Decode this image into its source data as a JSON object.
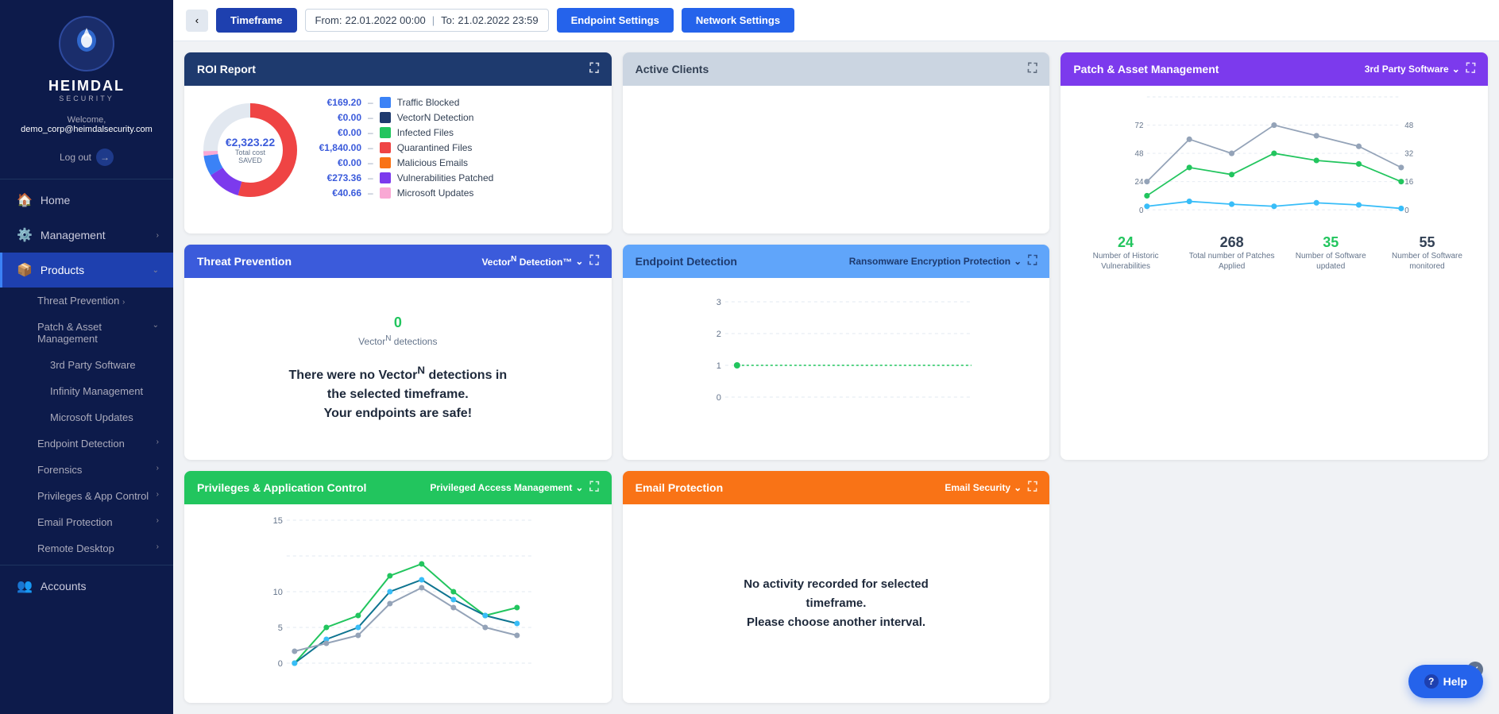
{
  "sidebar": {
    "logo_text": "HEIMDAL",
    "logo_sub": "SECURITY",
    "welcome": "Welcome,",
    "email": "demo_corp@heimdalsecurity.com",
    "logout": "Log out",
    "nav_items": [
      {
        "id": "home",
        "label": "Home",
        "icon": "🏠",
        "hasChildren": false,
        "active": false
      },
      {
        "id": "management",
        "label": "Management",
        "icon": "⚙️",
        "hasChildren": true,
        "active": false
      },
      {
        "id": "products",
        "label": "Products",
        "icon": "📦",
        "hasChildren": true,
        "active": true
      },
      {
        "id": "threat-prevention",
        "label": "Threat Prevention",
        "icon": "",
        "hasChildren": true,
        "active": false,
        "sub": true
      },
      {
        "id": "patch-asset",
        "label": "Patch & Asset Management",
        "icon": "",
        "hasChildren": true,
        "active": false,
        "sub": true
      },
      {
        "id": "3rd-party",
        "label": "3rd Party Software",
        "icon": "",
        "hasChildren": false,
        "active": false,
        "subsub": true
      },
      {
        "id": "infinity",
        "label": "Infinity Management",
        "icon": "",
        "hasChildren": false,
        "active": false,
        "subsub": true
      },
      {
        "id": "ms-updates",
        "label": "Microsoft Updates",
        "icon": "",
        "hasChildren": false,
        "active": false,
        "subsub": true
      },
      {
        "id": "endpoint-detection",
        "label": "Endpoint Detection",
        "icon": "",
        "hasChildren": true,
        "active": false,
        "sub": true
      },
      {
        "id": "forensics",
        "label": "Forensics",
        "icon": "",
        "hasChildren": true,
        "active": false,
        "sub": true
      },
      {
        "id": "privileges",
        "label": "Privileges & App Control",
        "icon": "",
        "hasChildren": true,
        "active": false,
        "sub": true
      },
      {
        "id": "email-protection",
        "label": "Email Protection",
        "icon": "",
        "hasChildren": true,
        "active": false,
        "sub": true
      },
      {
        "id": "remote-desktop",
        "label": "Remote Desktop",
        "icon": "",
        "hasChildren": true,
        "active": false,
        "sub": true
      },
      {
        "id": "accounts",
        "label": "Accounts",
        "icon": "👥",
        "hasChildren": false,
        "active": false
      }
    ]
  },
  "topbar": {
    "timeframe_label": "Timeframe",
    "from_label": "From:",
    "from_value": "22.01.2022 00:00",
    "to_label": "To:",
    "to_value": "21.02.2022 23:59",
    "endpoint_settings": "Endpoint Settings",
    "network_settings": "Network Settings"
  },
  "roi": {
    "title": "ROI Report",
    "amount": "€2,323.22",
    "sublabel": "Total cost SAVED",
    "legend": [
      {
        "color": "#3b82f6",
        "amount": "€169.20",
        "label": "Traffic Blocked"
      },
      {
        "color": "#1e3a6e",
        "amount": "€0.00",
        "label": "VectorN Detection"
      },
      {
        "color": "#22c55e",
        "amount": "€0.00",
        "label": "Infected Files"
      },
      {
        "color": "#ef4444",
        "amount": "€1,840.00",
        "label": "Quarantined Files"
      },
      {
        "color": "#f97316",
        "amount": "€0.00",
        "label": "Malicious Emails"
      },
      {
        "color": "#7c3aed",
        "amount": "€273.36",
        "label": "Vulnerabilities Patched"
      },
      {
        "color": "#f9a8d4",
        "amount": "€40.66",
        "label": "Microsoft Updates"
      }
    ]
  },
  "active_clients": {
    "title": "Active Clients"
  },
  "threat": {
    "title": "Threat Prevention",
    "dropdown": "VectorN Detection™",
    "count": "0",
    "count_label": "VectorN detections",
    "message_line1": "There were no VectorN detections in",
    "message_line2": "the selected timeframe.",
    "message_line3": "Your endpoints are safe!"
  },
  "patch": {
    "title": "Patch & Asset Management",
    "dropdown": "3rd Party Software",
    "stats": [
      {
        "num": "24",
        "color": "green",
        "label": "Number of Historic Vulnerabilities"
      },
      {
        "num": "268",
        "color": "dark",
        "label": "Total number of Patches Applied"
      },
      {
        "num": "35",
        "color": "green",
        "label": "Number of Software updated"
      },
      {
        "num": "55",
        "color": "dark",
        "label": "Number of Software monitored"
      }
    ]
  },
  "endpoint": {
    "title": "Endpoint Detection",
    "dropdown": "Ransomware Encryption Protection",
    "y_labels": [
      "0",
      "1",
      "2",
      "3"
    ]
  },
  "privileges": {
    "title": "Privileges & Application Control",
    "dropdown": "Privileged Access Management",
    "y_labels": [
      "0",
      "5",
      "10",
      "15"
    ]
  },
  "email": {
    "title": "Email Protection",
    "dropdown": "Email Security",
    "message_line1": "No activity recorded for selected",
    "message_line2": "timeframe.",
    "message_line3": "Please choose another interval."
  },
  "help": {
    "label": "Help"
  }
}
